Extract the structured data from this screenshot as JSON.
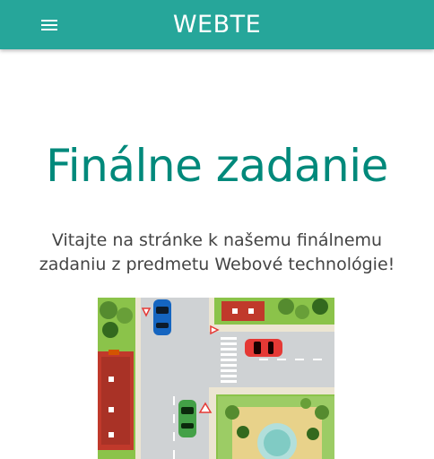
{
  "navbar": {
    "brand": "WEBTE",
    "menu_icon": "hamburger-menu-icon",
    "background_color": "#26a69a"
  },
  "main": {
    "title": "Finálne zadanie",
    "title_color": "#00897b",
    "intro": "Vitajte na stránke k našemu finálnemu zadaniu z predmetu Webové technológie!"
  },
  "illustration": {
    "description_icon": "intersection-illustration",
    "cars": [
      {
        "color": "#1565c0"
      },
      {
        "color": "#e53935"
      },
      {
        "color": "#43a047"
      }
    ]
  }
}
